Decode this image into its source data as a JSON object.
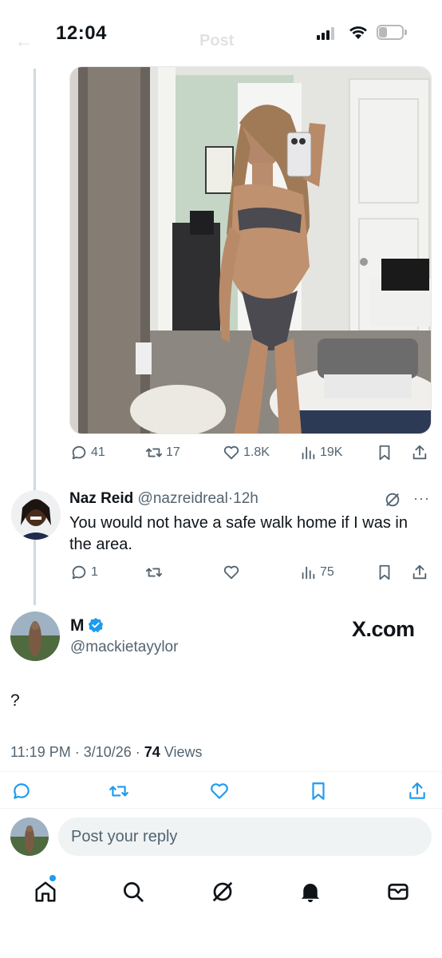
{
  "status_bar": {
    "time": "12:04",
    "battery": "3"
  },
  "faded_header": {
    "back_icon": "back-arrow-icon",
    "title": "Post"
  },
  "quoted_post": {
    "image_icon": "photo",
    "actions": {
      "replies": "41",
      "reposts": "17",
      "likes": "1.8K",
      "views": "19K"
    }
  },
  "reply": {
    "name": "Naz Reid",
    "handle": "@nazreidreal",
    "separator": "·",
    "time": "12h",
    "text": "You would not have a safe walk home if I was in the area.",
    "actions": {
      "replies": "1",
      "views": "75"
    }
  },
  "main_post": {
    "name": "M",
    "handle": "@mackietayylor",
    "watermark": "X.com",
    "text": "?",
    "time": "11:19 PM",
    "date": "3/10/26",
    "views_count": "74",
    "views_label": "Views"
  },
  "reply_box": {
    "placeholder": "Post your reply"
  },
  "colors": {
    "accent": "#1d9bf0",
    "text": "#0f1419",
    "secondary": "#536471",
    "divider": "#eff3f4"
  }
}
